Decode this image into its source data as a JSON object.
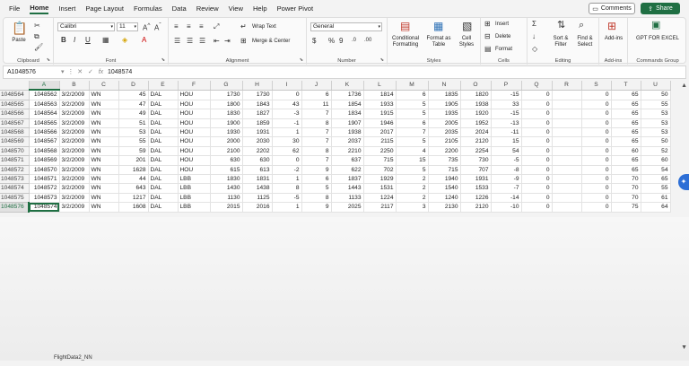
{
  "menu": [
    "File",
    "Home",
    "Insert",
    "Page Layout",
    "Formulas",
    "Data",
    "Review",
    "View",
    "Help",
    "Power Pivot"
  ],
  "active_menu": "Home",
  "buttons": {
    "comments": "Comments",
    "share": "Share"
  },
  "ribbon": {
    "clipboard": {
      "paste": "Paste",
      "label": "Clipboard"
    },
    "font": {
      "name": "Calibri",
      "size": "11",
      "label": "Font"
    },
    "alignment": {
      "wrap": "Wrap Text",
      "merge": "Merge & Center",
      "label": "Alignment"
    },
    "number": {
      "format": "General",
      "label": "Number"
    },
    "styles": {
      "conditional": "Conditional Formatting",
      "format_table": "Format as Table",
      "cell_styles": "Cell Styles",
      "label": "Styles"
    },
    "cells": {
      "insert": "Insert",
      "delete": "Delete",
      "format": "Format",
      "label": "Cells"
    },
    "editing": {
      "sort": "Sort & Filter",
      "find": "Find & Select",
      "label": "Editing"
    },
    "addins": {
      "addins": "Add-ins",
      "label": "Add-ins"
    },
    "gpt": {
      "name": "GPT FOR EXCEL",
      "label": "Commands Group"
    }
  },
  "formula_bar": {
    "name_box": "A1048576",
    "fx": "fx",
    "value": "1048574"
  },
  "columns": [
    "A",
    "B",
    "C",
    "D",
    "E",
    "F",
    "G",
    "H",
    "I",
    "J",
    "K",
    "L",
    "M",
    "N",
    "O",
    "P",
    "Q",
    "R",
    "S",
    "T",
    "U"
  ],
  "rows": [
    {
      "n": "1048564",
      "a": "1048562",
      "b": "3/2/2009",
      "c": "WN",
      "d": "45",
      "e": "DAL",
      "f": "HOU",
      "g": "1730",
      "h": "1730",
      "i": "0",
      "j": "6",
      "k": "1736",
      "l": "1814",
      "m": "6",
      "nn": "1835",
      "o": "1820",
      "p": "-15",
      "q": "0",
      "s": "0",
      "t": "65",
      "u": "50"
    },
    {
      "n": "1048565",
      "a": "1048563",
      "b": "3/2/2009",
      "c": "WN",
      "d": "47",
      "e": "DAL",
      "f": "HOU",
      "g": "1800",
      "h": "1843",
      "i": "43",
      "j": "11",
      "k": "1854",
      "l": "1933",
      "m": "5",
      "nn": "1905",
      "o": "1938",
      "p": "33",
      "q": "0",
      "s": "0",
      "t": "65",
      "u": "55"
    },
    {
      "n": "1048566",
      "a": "1048564",
      "b": "3/2/2009",
      "c": "WN",
      "d": "49",
      "e": "DAL",
      "f": "HOU",
      "g": "1830",
      "h": "1827",
      "i": "-3",
      "j": "7",
      "k": "1834",
      "l": "1915",
      "m": "5",
      "nn": "1935",
      "o": "1920",
      "p": "-15",
      "q": "0",
      "s": "0",
      "t": "65",
      "u": "53"
    },
    {
      "n": "1048567",
      "a": "1048565",
      "b": "3/2/2009",
      "c": "WN",
      "d": "51",
      "e": "DAL",
      "f": "HOU",
      "g": "1900",
      "h": "1859",
      "i": "-1",
      "j": "8",
      "k": "1907",
      "l": "1946",
      "m": "6",
      "nn": "2005",
      "o": "1952",
      "p": "-13",
      "q": "0",
      "s": "0",
      "t": "65",
      "u": "53"
    },
    {
      "n": "1048568",
      "a": "1048566",
      "b": "3/2/2009",
      "c": "WN",
      "d": "53",
      "e": "DAL",
      "f": "HOU",
      "g": "1930",
      "h": "1931",
      "i": "1",
      "j": "7",
      "k": "1938",
      "l": "2017",
      "m": "7",
      "nn": "2035",
      "o": "2024",
      "p": "-11",
      "q": "0",
      "s": "0",
      "t": "65",
      "u": "53"
    },
    {
      "n": "1048569",
      "a": "1048567",
      "b": "3/2/2009",
      "c": "WN",
      "d": "55",
      "e": "DAL",
      "f": "HOU",
      "g": "2000",
      "h": "2030",
      "i": "30",
      "j": "7",
      "k": "2037",
      "l": "2115",
      "m": "5",
      "nn": "2105",
      "o": "2120",
      "p": "15",
      "q": "0",
      "s": "0",
      "t": "65",
      "u": "50"
    },
    {
      "n": "1048570",
      "a": "1048568",
      "b": "3/2/2009",
      "c": "WN",
      "d": "59",
      "e": "DAL",
      "f": "HOU",
      "g": "2100",
      "h": "2202",
      "i": "62",
      "j": "8",
      "k": "2210",
      "l": "2250",
      "m": "4",
      "nn": "2200",
      "o": "2254",
      "p": "54",
      "q": "0",
      "s": "0",
      "t": "60",
      "u": "52"
    },
    {
      "n": "1048571",
      "a": "1048569",
      "b": "3/2/2009",
      "c": "WN",
      "d": "201",
      "e": "DAL",
      "f": "HOU",
      "g": "630",
      "h": "630",
      "i": "0",
      "j": "7",
      "k": "637",
      "l": "715",
      "m": "15",
      "nn": "735",
      "o": "730",
      "p": "-5",
      "q": "0",
      "s": "0",
      "t": "65",
      "u": "60"
    },
    {
      "n": "1048572",
      "a": "1048570",
      "b": "3/2/2009",
      "c": "WN",
      "d": "1628",
      "e": "DAL",
      "f": "HOU",
      "g": "615",
      "h": "613",
      "i": "-2",
      "j": "9",
      "k": "622",
      "l": "702",
      "m": "5",
      "nn": "715",
      "o": "707",
      "p": "-8",
      "q": "0",
      "s": "0",
      "t": "65",
      "u": "54"
    },
    {
      "n": "1048573",
      "a": "1048571",
      "b": "3/2/2009",
      "c": "WN",
      "d": "44",
      "e": "DAL",
      "f": "LBB",
      "g": "1830",
      "h": "1831",
      "i": "1",
      "j": "6",
      "k": "1837",
      "l": "1929",
      "m": "2",
      "nn": "1940",
      "o": "1931",
      "p": "-9",
      "q": "0",
      "s": "0",
      "t": "70",
      "u": "65"
    },
    {
      "n": "1048574",
      "a": "1048572",
      "b": "3/2/2009",
      "c": "WN",
      "d": "643",
      "e": "DAL",
      "f": "LBB",
      "g": "1430",
      "h": "1438",
      "i": "8",
      "j": "5",
      "k": "1443",
      "l": "1531",
      "m": "2",
      "nn": "1540",
      "o": "1533",
      "p": "-7",
      "q": "0",
      "s": "0",
      "t": "70",
      "u": "55"
    },
    {
      "n": "1048575",
      "a": "1048573",
      "b": "3/2/2009",
      "c": "WN",
      "d": "1217",
      "e": "DAL",
      "f": "LBB",
      "g": "1130",
      "h": "1125",
      "i": "-5",
      "j": "8",
      "k": "1133",
      "l": "1224",
      "m": "2",
      "nn": "1240",
      "o": "1226",
      "p": "-14",
      "q": "0",
      "s": "0",
      "t": "70",
      "u": "61"
    },
    {
      "n": "1048576",
      "a": "1048574",
      "b": "3/2/2009",
      "c": "WN",
      "d": "1608",
      "e": "DAL",
      "f": "LBB",
      "g": "2015",
      "h": "2016",
      "i": "1",
      "j": "9",
      "k": "2025",
      "l": "2117",
      "m": "3",
      "nn": "2130",
      "o": "2120",
      "p": "-10",
      "q": "0",
      "s": "0",
      "t": "75",
      "u": "64"
    }
  ],
  "sheet_tab": "FlightData2_NN",
  "colors": {
    "accent": "#1f6f43",
    "badge": "#2d6fd6"
  }
}
